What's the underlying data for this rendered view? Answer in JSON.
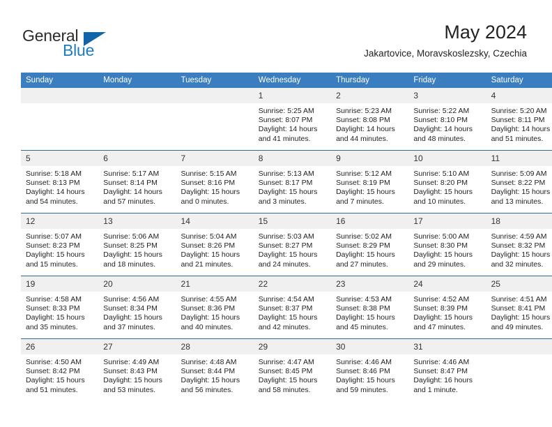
{
  "brand": {
    "name_part1": "General",
    "name_part2": "Blue"
  },
  "header": {
    "title": "May 2024",
    "subtitle": "Jakartovice, Moravskoslezsky, Czechia"
  },
  "colors": {
    "header_blue": "#3b7ebf",
    "grid_line": "#2f6ba3",
    "daynum_bg": "#f0f0f0",
    "brand_blue": "#1f7bc1",
    "brand_triangle": "#1165a8"
  },
  "calendar": {
    "weekday_headers": [
      "Sunday",
      "Monday",
      "Tuesday",
      "Wednesday",
      "Thursday",
      "Friday",
      "Saturday"
    ],
    "weeks": [
      [
        {
          "day": "",
          "empty": true
        },
        {
          "day": "",
          "empty": true
        },
        {
          "day": "",
          "empty": true
        },
        {
          "day": "1",
          "sunrise": "Sunrise: 5:25 AM",
          "sunset": "Sunset: 8:07 PM",
          "daylight_l1": "Daylight: 14 hours",
          "daylight_l2": "and 41 minutes."
        },
        {
          "day": "2",
          "sunrise": "Sunrise: 5:23 AM",
          "sunset": "Sunset: 8:08 PM",
          "daylight_l1": "Daylight: 14 hours",
          "daylight_l2": "and 44 minutes."
        },
        {
          "day": "3",
          "sunrise": "Sunrise: 5:22 AM",
          "sunset": "Sunset: 8:10 PM",
          "daylight_l1": "Daylight: 14 hours",
          "daylight_l2": "and 48 minutes."
        },
        {
          "day": "4",
          "sunrise": "Sunrise: 5:20 AM",
          "sunset": "Sunset: 8:11 PM",
          "daylight_l1": "Daylight: 14 hours",
          "daylight_l2": "and 51 minutes."
        }
      ],
      [
        {
          "day": "5",
          "sunrise": "Sunrise: 5:18 AM",
          "sunset": "Sunset: 8:13 PM",
          "daylight_l1": "Daylight: 14 hours",
          "daylight_l2": "and 54 minutes."
        },
        {
          "day": "6",
          "sunrise": "Sunrise: 5:17 AM",
          "sunset": "Sunset: 8:14 PM",
          "daylight_l1": "Daylight: 14 hours",
          "daylight_l2": "and 57 minutes."
        },
        {
          "day": "7",
          "sunrise": "Sunrise: 5:15 AM",
          "sunset": "Sunset: 8:16 PM",
          "daylight_l1": "Daylight: 15 hours",
          "daylight_l2": "and 0 minutes."
        },
        {
          "day": "8",
          "sunrise": "Sunrise: 5:13 AM",
          "sunset": "Sunset: 8:17 PM",
          "daylight_l1": "Daylight: 15 hours",
          "daylight_l2": "and 3 minutes."
        },
        {
          "day": "9",
          "sunrise": "Sunrise: 5:12 AM",
          "sunset": "Sunset: 8:19 PM",
          "daylight_l1": "Daylight: 15 hours",
          "daylight_l2": "and 7 minutes."
        },
        {
          "day": "10",
          "sunrise": "Sunrise: 5:10 AM",
          "sunset": "Sunset: 8:20 PM",
          "daylight_l1": "Daylight: 15 hours",
          "daylight_l2": "and 10 minutes."
        },
        {
          "day": "11",
          "sunrise": "Sunrise: 5:09 AM",
          "sunset": "Sunset: 8:22 PM",
          "daylight_l1": "Daylight: 15 hours",
          "daylight_l2": "and 13 minutes."
        }
      ],
      [
        {
          "day": "12",
          "sunrise": "Sunrise: 5:07 AM",
          "sunset": "Sunset: 8:23 PM",
          "daylight_l1": "Daylight: 15 hours",
          "daylight_l2": "and 15 minutes."
        },
        {
          "day": "13",
          "sunrise": "Sunrise: 5:06 AM",
          "sunset": "Sunset: 8:25 PM",
          "daylight_l1": "Daylight: 15 hours",
          "daylight_l2": "and 18 minutes."
        },
        {
          "day": "14",
          "sunrise": "Sunrise: 5:04 AM",
          "sunset": "Sunset: 8:26 PM",
          "daylight_l1": "Daylight: 15 hours",
          "daylight_l2": "and 21 minutes."
        },
        {
          "day": "15",
          "sunrise": "Sunrise: 5:03 AM",
          "sunset": "Sunset: 8:27 PM",
          "daylight_l1": "Daylight: 15 hours",
          "daylight_l2": "and 24 minutes."
        },
        {
          "day": "16",
          "sunrise": "Sunrise: 5:02 AM",
          "sunset": "Sunset: 8:29 PM",
          "daylight_l1": "Daylight: 15 hours",
          "daylight_l2": "and 27 minutes."
        },
        {
          "day": "17",
          "sunrise": "Sunrise: 5:00 AM",
          "sunset": "Sunset: 8:30 PM",
          "daylight_l1": "Daylight: 15 hours",
          "daylight_l2": "and 29 minutes."
        },
        {
          "day": "18",
          "sunrise": "Sunrise: 4:59 AM",
          "sunset": "Sunset: 8:32 PM",
          "daylight_l1": "Daylight: 15 hours",
          "daylight_l2": "and 32 minutes."
        }
      ],
      [
        {
          "day": "19",
          "sunrise": "Sunrise: 4:58 AM",
          "sunset": "Sunset: 8:33 PM",
          "daylight_l1": "Daylight: 15 hours",
          "daylight_l2": "and 35 minutes."
        },
        {
          "day": "20",
          "sunrise": "Sunrise: 4:56 AM",
          "sunset": "Sunset: 8:34 PM",
          "daylight_l1": "Daylight: 15 hours",
          "daylight_l2": "and 37 minutes."
        },
        {
          "day": "21",
          "sunrise": "Sunrise: 4:55 AM",
          "sunset": "Sunset: 8:36 PM",
          "daylight_l1": "Daylight: 15 hours",
          "daylight_l2": "and 40 minutes."
        },
        {
          "day": "22",
          "sunrise": "Sunrise: 4:54 AM",
          "sunset": "Sunset: 8:37 PM",
          "daylight_l1": "Daylight: 15 hours",
          "daylight_l2": "and 42 minutes."
        },
        {
          "day": "23",
          "sunrise": "Sunrise: 4:53 AM",
          "sunset": "Sunset: 8:38 PM",
          "daylight_l1": "Daylight: 15 hours",
          "daylight_l2": "and 45 minutes."
        },
        {
          "day": "24",
          "sunrise": "Sunrise: 4:52 AM",
          "sunset": "Sunset: 8:39 PM",
          "daylight_l1": "Daylight: 15 hours",
          "daylight_l2": "and 47 minutes."
        },
        {
          "day": "25",
          "sunrise": "Sunrise: 4:51 AM",
          "sunset": "Sunset: 8:41 PM",
          "daylight_l1": "Daylight: 15 hours",
          "daylight_l2": "and 49 minutes."
        }
      ],
      [
        {
          "day": "26",
          "sunrise": "Sunrise: 4:50 AM",
          "sunset": "Sunset: 8:42 PM",
          "daylight_l1": "Daylight: 15 hours",
          "daylight_l2": "and 51 minutes."
        },
        {
          "day": "27",
          "sunrise": "Sunrise: 4:49 AM",
          "sunset": "Sunset: 8:43 PM",
          "daylight_l1": "Daylight: 15 hours",
          "daylight_l2": "and 53 minutes."
        },
        {
          "day": "28",
          "sunrise": "Sunrise: 4:48 AM",
          "sunset": "Sunset: 8:44 PM",
          "daylight_l1": "Daylight: 15 hours",
          "daylight_l2": "and 56 minutes."
        },
        {
          "day": "29",
          "sunrise": "Sunrise: 4:47 AM",
          "sunset": "Sunset: 8:45 PM",
          "daylight_l1": "Daylight: 15 hours",
          "daylight_l2": "and 58 minutes."
        },
        {
          "day": "30",
          "sunrise": "Sunrise: 4:46 AM",
          "sunset": "Sunset: 8:46 PM",
          "daylight_l1": "Daylight: 15 hours",
          "daylight_l2": "and 59 minutes."
        },
        {
          "day": "31",
          "sunrise": "Sunrise: 4:46 AM",
          "sunset": "Sunset: 8:47 PM",
          "daylight_l1": "Daylight: 16 hours",
          "daylight_l2": "and 1 minute."
        },
        {
          "day": "",
          "empty": true
        }
      ]
    ]
  }
}
